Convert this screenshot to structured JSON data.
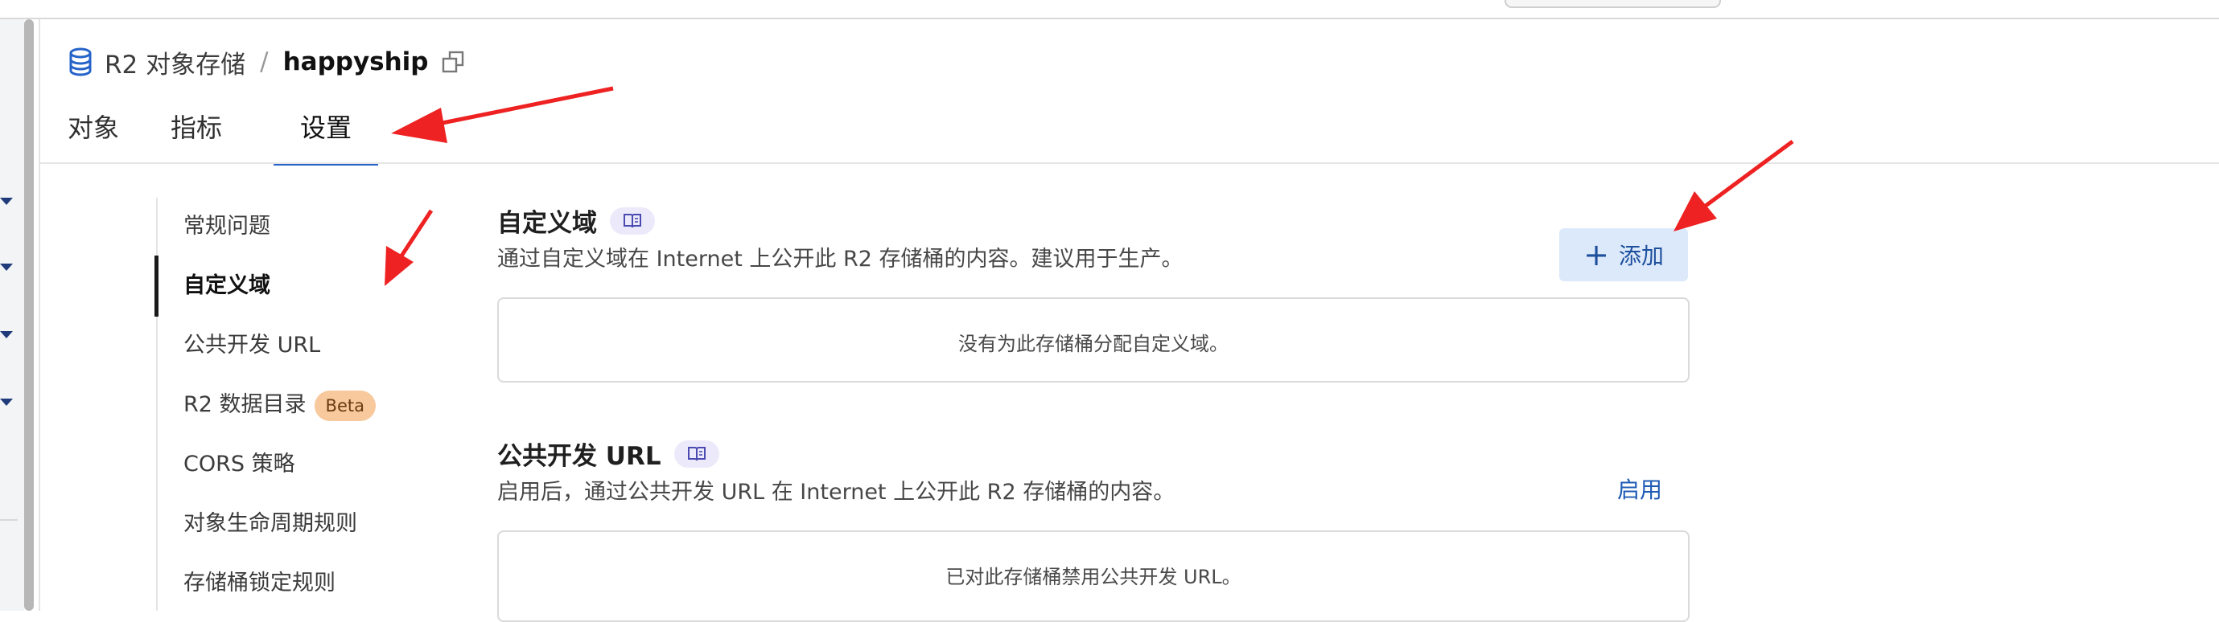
{
  "breadcrumb": {
    "root": "R2 对象存储",
    "separator": "/",
    "bucket": "happyship"
  },
  "tabs": [
    {
      "label": "对象"
    },
    {
      "label": "指标"
    },
    {
      "label": "设置",
      "active": true
    }
  ],
  "settings_nav": [
    {
      "label": "常规问题"
    },
    {
      "label": "自定义域",
      "active": true
    },
    {
      "label": "公共开发 URL"
    },
    {
      "label": "R2 数据目录",
      "badge": "Beta"
    },
    {
      "label": "CORS 策略"
    },
    {
      "label": "对象生命周期规则"
    },
    {
      "label": "存储桶锁定规则"
    }
  ],
  "custom_domain": {
    "title": "自定义域",
    "description": "通过自定义域在 Internet 上公开此 R2 存储桶的内容。建议用于生产。",
    "add_button": "添加",
    "empty_state": "没有为此存储桶分配自定义域。"
  },
  "public_dev_url": {
    "title": "公共开发 URL",
    "description": "启用后，通过公共开发 URL 在 Internet 上公开此 R2 存储桶的内容。",
    "enable_link": "启用",
    "disabled_state": "已对此存储桶禁用公共开发 URL。"
  },
  "colors": {
    "accent": "#2563c9",
    "button_bg": "#dbe9fb",
    "beta_badge": "#f7c99c",
    "annotation_arrow": "#ee2222"
  }
}
